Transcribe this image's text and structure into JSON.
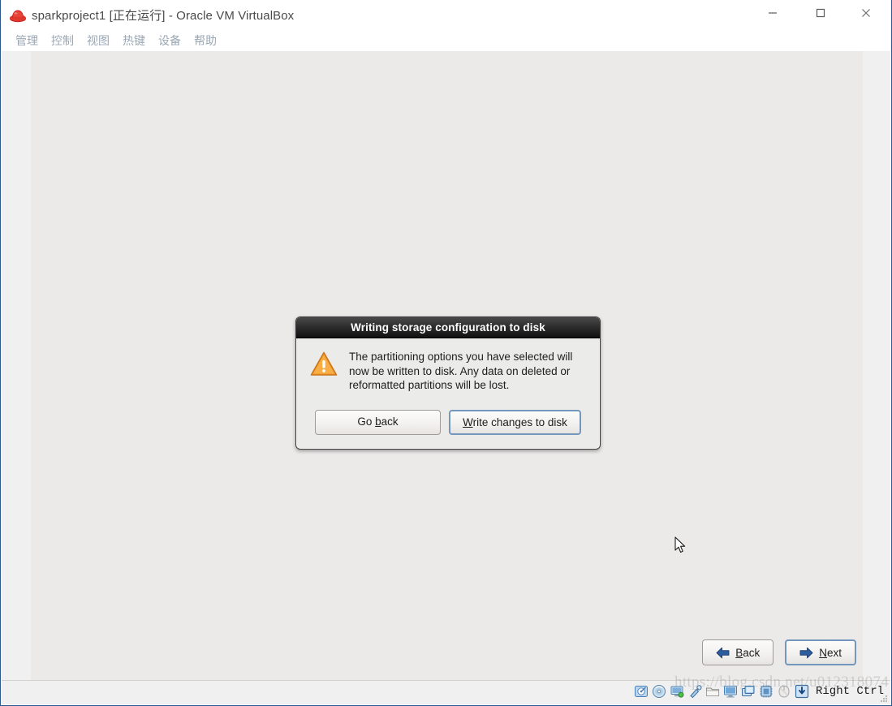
{
  "host_window": {
    "title": "sparkproject1 [正在运行] - Oracle VM VirtualBox",
    "app_icon": "redhat-logo-icon",
    "window_controls": [
      {
        "name": "minimize-button",
        "icon": "minimize-icon",
        "label": "—"
      },
      {
        "name": "maximize-button",
        "icon": "maximize-icon",
        "label": "□"
      },
      {
        "name": "close-button",
        "icon": "close-icon",
        "label": "✕"
      }
    ],
    "menubar": [
      {
        "label": "管理",
        "name": "menu-manage"
      },
      {
        "label": "控制",
        "name": "menu-control"
      },
      {
        "label": "视图",
        "name": "menu-view"
      },
      {
        "label": "热键",
        "name": "menu-hotkey"
      },
      {
        "label": "设备",
        "name": "menu-devices"
      },
      {
        "label": "帮助",
        "name": "menu-help"
      }
    ]
  },
  "guest": {
    "installer_nav": {
      "back_label_pre": "",
      "back_accel": "B",
      "back_label_post": "ack",
      "next_accel": "N",
      "next_label_post": "ext",
      "back_full": "Back",
      "next_full": "Next"
    },
    "dialog": {
      "title": "Writing storage configuration to disk",
      "icon": "warning-triangle-icon",
      "message": "The partitioning options you have selected will now be written to disk.  Any data on deleted or reformatted partitions will be lost.",
      "buttons": [
        {
          "name": "go-back-button",
          "text_before": "Go ",
          "accel": "b",
          "text_after": "ack",
          "full": "Go back",
          "default": false
        },
        {
          "name": "write-changes-button",
          "text_before": "",
          "accel": "W",
          "text_after": "rite changes to disk",
          "full": "Write changes to disk",
          "default": true
        }
      ]
    }
  },
  "statusbar": {
    "host_key": "Right Ctrl",
    "icons": [
      {
        "name": "hard-disk-icon",
        "tooltip": "hard-disks"
      },
      {
        "name": "optical-disk-icon",
        "tooltip": "cd-dvd"
      },
      {
        "name": "network-icon",
        "tooltip": "network-adapters"
      },
      {
        "name": "usb-icon",
        "tooltip": "usb-devices"
      },
      {
        "name": "shared-folder-icon",
        "tooltip": "shared-folders"
      },
      {
        "name": "display-icon",
        "tooltip": "display"
      },
      {
        "name": "video-capture-icon",
        "tooltip": "recording"
      },
      {
        "name": "cpu-icon",
        "tooltip": "features"
      },
      {
        "name": "mouse-icon",
        "tooltip": "mouse-integration"
      },
      {
        "name": "host-key-icon",
        "tooltip": "host-key"
      }
    ],
    "resize_grip": "resize-grip-icon"
  },
  "watermark": {
    "text": "https://blog.csdn.net/u012318074"
  },
  "colors": {
    "accent_blue": "#2b5b8c",
    "focus_blue": "#7596bd",
    "warning_orange": "#f0a030",
    "dialog_bg": "#ebebe9",
    "guest_bg": "#eceae9",
    "host_bg": "#f0f0f0",
    "menu_text": "#9aa7b4"
  }
}
